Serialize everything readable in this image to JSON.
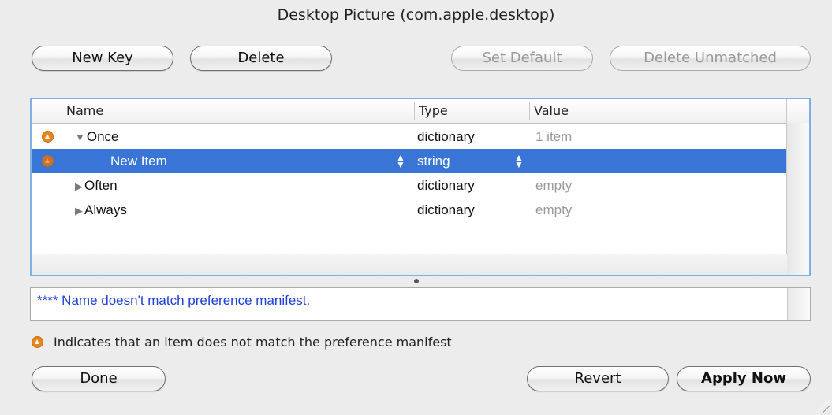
{
  "window": {
    "title": "Desktop Picture (com.apple.desktop)"
  },
  "toolbar": {
    "new_key": "New Key",
    "delete": "Delete",
    "set_default": "Set Default",
    "delete_unmatched": "Delete Unmatched"
  },
  "table": {
    "columns": {
      "name": "Name",
      "type": "Type",
      "value": "Value"
    },
    "rows": [
      {
        "name": "Once",
        "type": "dictionary",
        "value": "1 item",
        "expanded": true,
        "warning": true
      },
      {
        "name": "New Item",
        "type": "string",
        "value": "",
        "selected": true,
        "warning": true
      },
      {
        "name": "Often",
        "type": "dictionary",
        "value": "empty",
        "expanded": false
      },
      {
        "name": "Always",
        "type": "dictionary",
        "value": "empty",
        "expanded": false
      }
    ]
  },
  "message": {
    "text": "**** Name doesn't match preference manifest."
  },
  "legend": {
    "text": "Indicates that an item does not match the preference manifest"
  },
  "footer": {
    "done": "Done",
    "revert": "Revert",
    "apply_now": "Apply Now"
  },
  "colors": {
    "selection": "#3875d7",
    "warning": "#e8861a",
    "message": "#1c3fd8",
    "focus_ring": "#7eb0e6"
  }
}
